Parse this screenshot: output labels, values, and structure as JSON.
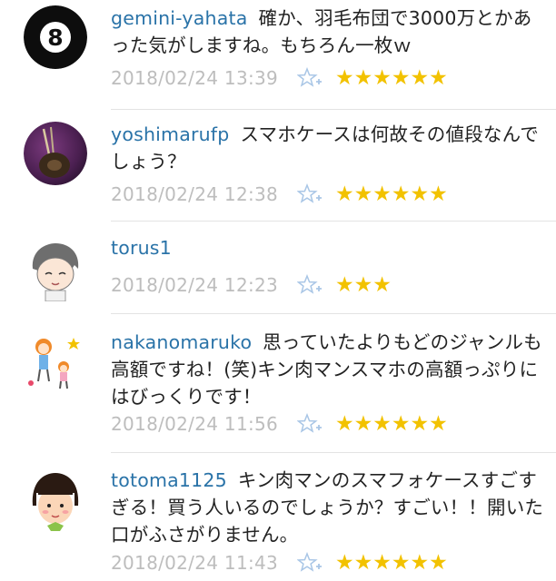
{
  "accent_color": "#2a73a8",
  "star_color": "#f2c200",
  "add_star_icon": "star-plus-icon",
  "comments": [
    {
      "user": "gemini-yahata",
      "text": "確か、羽毛布団で3000万とかあった気がしますね。もちろん一枚ｗ",
      "time": "2018/02/24 13:39",
      "stars": "★★★★★★",
      "star_count": 6,
      "avatar_icon": "eight-ball-icon"
    },
    {
      "user": "yoshimarufp",
      "text": "スマホケースは何故その値段なんでしょう？",
      "time": "2018/02/24 12:38",
      "stars": "★★★★★★",
      "star_count": 6,
      "avatar_icon": "guitar-photo-icon"
    },
    {
      "user": "torus1",
      "text": "",
      "time": "2018/02/24 12:23",
      "stars": "★★★",
      "star_count": 3,
      "avatar_icon": "cartoon-face-icon"
    },
    {
      "user": "nakanomaruko",
      "text": "思っていたよりもどのジャンルも高額ですね！(笑)キン肉マンスマホの高額っぷりにはびっくりです！",
      "time": "2018/02/24 11:56",
      "stars": "★★★★★★",
      "star_count": 6,
      "avatar_icon": "girl-drawing-icon"
    },
    {
      "user": "totoma1125",
      "text": "キン肉マンのスマフォケースすごすぎる！買う人いるのでしょうか？すごい！！開いた口がふさがりません。",
      "time": "2018/02/24 11:43",
      "stars": "★★★★★★",
      "star_count": 6,
      "avatar_icon": "girl-face-icon"
    }
  ]
}
